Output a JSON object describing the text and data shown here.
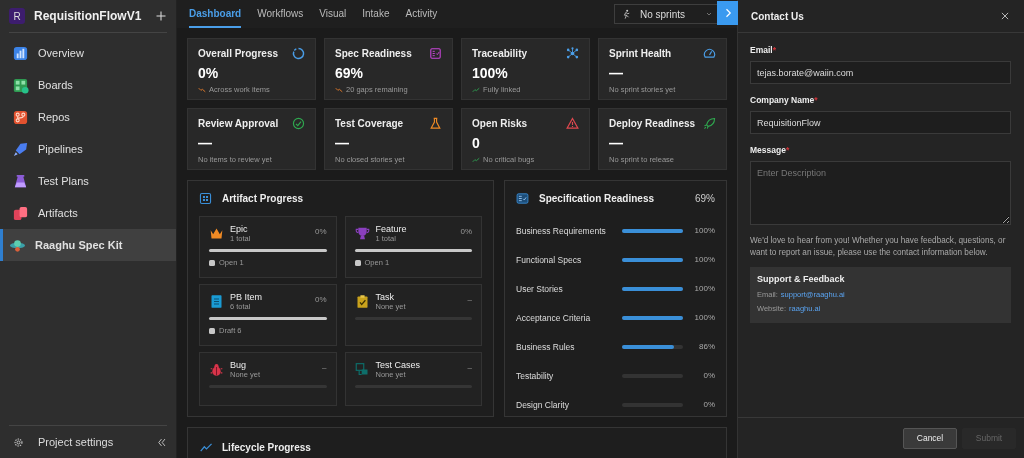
{
  "sidebar": {
    "project": {
      "initial": "R",
      "name": "RequisitionFlowV1"
    },
    "items": [
      {
        "label": "Overview",
        "selected": false
      },
      {
        "label": "Boards",
        "selected": false
      },
      {
        "label": "Repos",
        "selected": false
      },
      {
        "label": "Pipelines",
        "selected": false
      },
      {
        "label": "Test Plans",
        "selected": false
      },
      {
        "label": "Artifacts",
        "selected": false
      },
      {
        "label": "Raaghu Spec Kit",
        "selected": true
      }
    ],
    "footer": {
      "label": "Project settings"
    }
  },
  "tabs": [
    {
      "label": "Dashboard",
      "selected": true
    },
    {
      "label": "Workflows",
      "selected": false
    },
    {
      "label": "Visual",
      "selected": false
    },
    {
      "label": "Intake",
      "selected": false
    },
    {
      "label": "Activity",
      "selected": false
    }
  ],
  "sprint_dropdown": {
    "value": "No sprints"
  },
  "stat_cards": [
    {
      "title": "Overall Progress",
      "value": "0%",
      "note": "Across work items",
      "kind": "falling"
    },
    {
      "title": "Spec Readiness",
      "value": "69%",
      "note": "20 gaps remaining",
      "kind": "falling"
    },
    {
      "title": "Traceability",
      "value": "100%",
      "note": "Fully linked",
      "kind": "rising"
    },
    {
      "title": "Sprint Health",
      "value": "—",
      "note": "No sprint stories yet",
      "kind": "plain"
    },
    {
      "title": "Review Approval",
      "value": "—",
      "note": "No items to review yet",
      "kind": "plain"
    },
    {
      "title": "Test Coverage",
      "value": "—",
      "note": "No closed stories yet",
      "kind": "plain"
    },
    {
      "title": "Open Risks",
      "value": "0",
      "note": "No critical bugs",
      "kind": "rising"
    },
    {
      "title": "Deploy Readiness",
      "value": "—",
      "note": "No sprint to release",
      "kind": "plain"
    }
  ],
  "artifact_progress": {
    "title": "Artifact Progress",
    "items": [
      {
        "name": "Epic",
        "count": "1 total",
        "percent": "0%",
        "level": 0,
        "legend": "Open 1"
      },
      {
        "name": "Feature",
        "count": "1 total",
        "percent": "0%",
        "level": 0,
        "legend": "Open 1"
      },
      {
        "name": "PB Item",
        "count": "6 total",
        "percent": "0%",
        "level": 0,
        "legend": "Draft 6"
      },
      {
        "name": "Task",
        "count": "None yet",
        "percent": "–",
        "level": 0
      },
      {
        "name": "Bug",
        "count": "None yet",
        "percent": "–",
        "level": 0
      },
      {
        "name": "Test Cases",
        "count": "None yet",
        "percent": "–",
        "level": 0
      }
    ]
  },
  "specification_readiness": {
    "title": "Specification Readiness",
    "percent": "69%",
    "rows": [
      {
        "label": "Business Requirements",
        "level": 1,
        "percent": "100%"
      },
      {
        "label": "Functional Specs",
        "level": 1,
        "percent": "100%"
      },
      {
        "label": "User Stories",
        "level": 1,
        "percent": "100%"
      },
      {
        "label": "Acceptance Criteria",
        "level": 1,
        "percent": "100%"
      },
      {
        "label": "Business Rules",
        "level": 0.86,
        "percent": "86%"
      },
      {
        "label": "Testability",
        "level": 0,
        "percent": "0%"
      },
      {
        "label": "Design Clarity",
        "level": 0,
        "percent": "0%"
      }
    ]
  },
  "lifecycle_progress": {
    "title": "Lifecycle Progress"
  },
  "contact_panel": {
    "title": "Contact Us",
    "fields": [
      {
        "label": "Email",
        "mark": "*",
        "kind": "input",
        "value": "tejas.borate@waiin.com"
      },
      {
        "label": "Company Name",
        "mark": "*",
        "kind": "input",
        "value": "RequisitionFlow"
      },
      {
        "label": "Message",
        "mark": "*",
        "kind": "textarea",
        "placeholder": "Enter Description"
      }
    ],
    "intro": "We'd love to hear from you! Whether you have feedback, questions, or want to report an issue, please use the contact information below.",
    "support": {
      "title": "Support & Feedback",
      "lines": [
        {
          "label": "Email:",
          "link": "support@raaghu.ai"
        },
        {
          "label": "Website:",
          "link": "raaghu.ai"
        }
      ]
    },
    "buttons": [
      {
        "label": "Cancel",
        "disabled": false
      },
      {
        "label": "Submit",
        "disabled": true
      }
    ]
  }
}
